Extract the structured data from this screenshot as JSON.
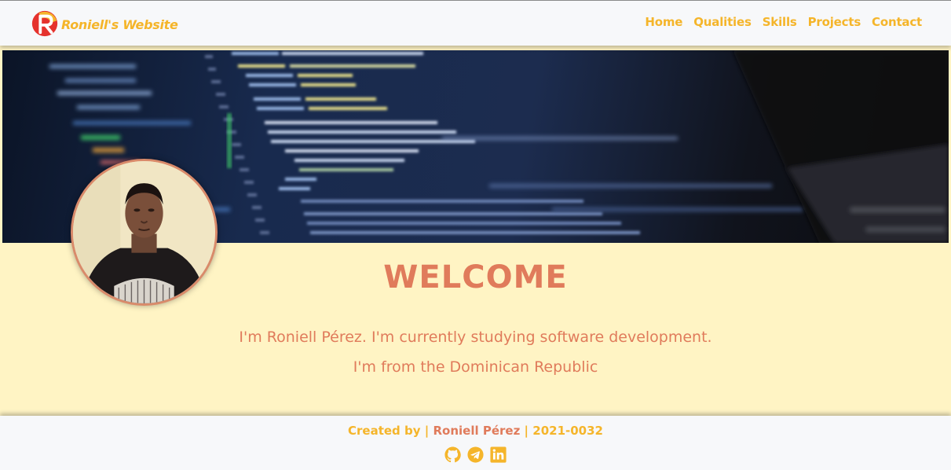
{
  "navbar": {
    "brand_letter": "R",
    "brand_name": "Roniell's Website",
    "links": [
      "Home",
      "Qualities",
      "Skills",
      "Projects",
      "Contact"
    ]
  },
  "hero": {
    "heading": "WELCOME",
    "intro_line_1": "I'm Roniell Pérez. I'm currently studying software development.",
    "intro_line_2": "I'm from the Dominican Republic"
  },
  "footer": {
    "created_by": "Created by",
    "separator": "|",
    "author": "Roniell Pérez",
    "student_id": "2021-0032",
    "social_icons": [
      "github-icon",
      "telegram-icon",
      "linkedin-icon"
    ]
  },
  "colors": {
    "accent_yellow": "#f5b52a",
    "accent_coral": "#e07b5b",
    "page_background": "#fff4c4",
    "bar_background": "#f7f8fa",
    "logo_red": "#e5322d"
  }
}
